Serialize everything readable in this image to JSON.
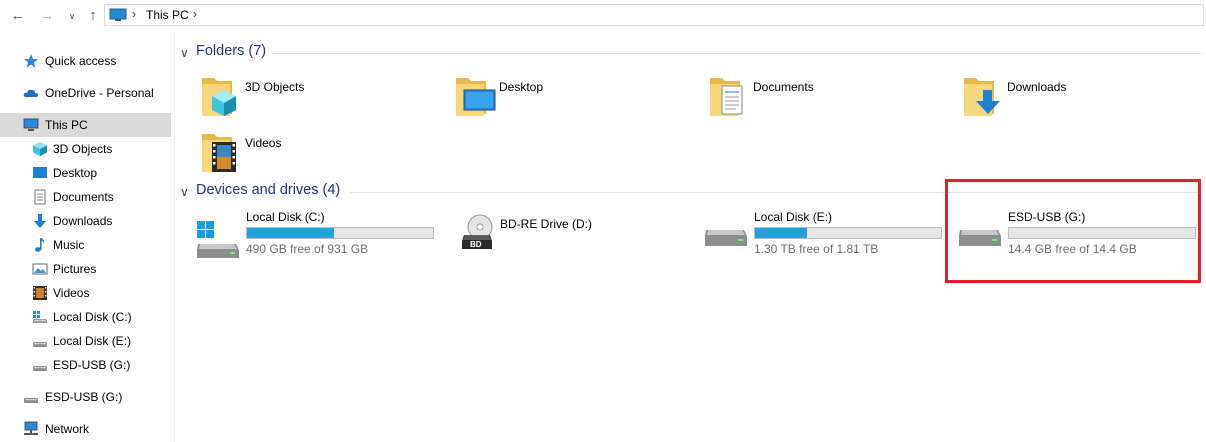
{
  "address_bar": {
    "path": "This PC",
    "icons": {
      "back": "arrow-left-icon",
      "forward": "arrow-right-icon",
      "recent": "chevron-down-icon",
      "up": "arrow-up-icon",
      "location": "computer-icon"
    }
  },
  "sidebar": {
    "items": [
      {
        "label": "Quick access",
        "icon": "star-icon",
        "level": 0
      },
      {
        "label": "OneDrive - Personal",
        "icon": "cloud-icon",
        "level": 0
      },
      {
        "label": "This PC",
        "icon": "computer-icon",
        "level": 0,
        "selected": true
      },
      {
        "label": "3D Objects",
        "icon": "cube-icon",
        "level": 1
      },
      {
        "label": "Desktop",
        "icon": "desktop-icon",
        "level": 1
      },
      {
        "label": "Documents",
        "icon": "document-icon",
        "level": 1
      },
      {
        "label": "Downloads",
        "icon": "download-icon",
        "level": 1
      },
      {
        "label": "Music",
        "icon": "music-note-icon",
        "level": 1
      },
      {
        "label": "Pictures",
        "icon": "picture-icon",
        "level": 1
      },
      {
        "label": "Videos",
        "icon": "film-icon",
        "level": 1
      },
      {
        "label": "Local Disk (C:)",
        "icon": "windows-drive-icon",
        "level": 1
      },
      {
        "label": "Local Disk (E:)",
        "icon": "drive-icon",
        "level": 1
      },
      {
        "label": "ESD-USB (G:)",
        "icon": "drive-icon",
        "level": 1
      },
      {
        "label": "ESD-USB (G:)",
        "icon": "drive-icon",
        "level": 0
      },
      {
        "label": "Network",
        "icon": "network-icon",
        "level": 0
      }
    ]
  },
  "folders_group": {
    "title": "Folders (7)",
    "items": [
      {
        "label": "3D Objects",
        "icon": "3d-objects-folder-icon"
      },
      {
        "label": "Desktop",
        "icon": "desktop-folder-icon"
      },
      {
        "label": "Documents",
        "icon": "documents-folder-icon"
      },
      {
        "label": "Downloads",
        "icon": "downloads-folder-icon"
      },
      {
        "label": "Videos",
        "icon": "videos-folder-icon"
      }
    ]
  },
  "drives_group": {
    "title": "Devices and drives (4)",
    "items": [
      {
        "label": "Local Disk (C:)",
        "free": "490 GB free of 931 GB",
        "used_fraction": 0.47,
        "icon": "windows-drive-icon"
      },
      {
        "label": "BD-RE Drive (D:)",
        "icon": "bd-drive-icon"
      },
      {
        "label": "Local Disk (E:)",
        "free": "1.30 TB free of 1.81 TB",
        "used_fraction": 0.28,
        "icon": "drive-icon"
      },
      {
        "label": "ESD-USB (G:)",
        "free": "14.4 GB free of 14.4 GB",
        "used_fraction": 0.0,
        "icon": "drive-icon"
      }
    ]
  },
  "colors": {
    "accent": "#26a0da",
    "group_title": "#1e3287",
    "selection": "#d9d9d9",
    "highlight": "#e0202b"
  }
}
